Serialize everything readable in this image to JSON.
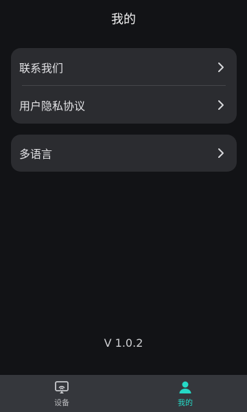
{
  "header": {
    "title": "我的"
  },
  "settings_group_1": {
    "items": [
      {
        "label": "联系我们"
      },
      {
        "label": "用户隐私协议"
      }
    ]
  },
  "settings_group_2": {
    "items": [
      {
        "label": "多语言"
      }
    ]
  },
  "footer": {
    "version": "V 1.0.2"
  },
  "tabbar": {
    "tabs": [
      {
        "label": "设备",
        "icon": "device-screen-icon",
        "active": false
      },
      {
        "label": "我的",
        "icon": "user-icon",
        "active": true
      }
    ]
  },
  "colors": {
    "background": "#121316",
    "card": "#2b2c30",
    "tabbar": "#35373c",
    "accent": "#25d9c6"
  }
}
